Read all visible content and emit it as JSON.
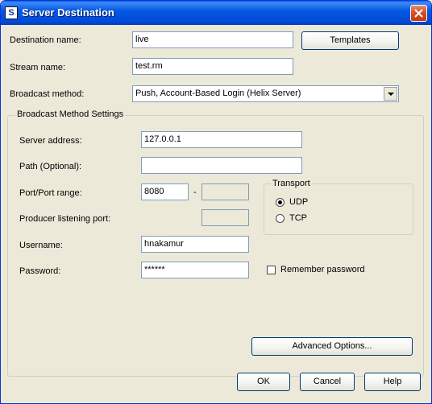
{
  "window": {
    "title": "Server Destination"
  },
  "form": {
    "destination_name": {
      "label": "Destination name:",
      "value": "live"
    },
    "templates_button": "Templates",
    "stream_name": {
      "label": "Stream name:",
      "value": "test.rm"
    },
    "broadcast_method": {
      "label": "Broadcast method:",
      "value": "Push, Account-Based Login (Helix Server)"
    }
  },
  "settings": {
    "group_title": "Broadcast Method Settings",
    "server_address": {
      "label": "Server address:",
      "value": "127.0.0.1"
    },
    "path": {
      "label": "Path (Optional):",
      "value": ""
    },
    "port_range": {
      "label": "Port/Port range:",
      "value_from": "8080",
      "separator": "-",
      "value_to": ""
    },
    "producer_port": {
      "label": "Producer listening port:",
      "value": ""
    },
    "username": {
      "label": "Username:",
      "value": "hnakamur"
    },
    "password": {
      "label": "Password:",
      "value": "******"
    },
    "remember_password": {
      "label": "Remember password",
      "checked": false
    },
    "transport": {
      "title": "Transport",
      "options": [
        {
          "label": "UDP",
          "selected": true
        },
        {
          "label": "TCP",
          "selected": false
        }
      ]
    },
    "advanced_button": "Advanced Options..."
  },
  "footer": {
    "ok": "OK",
    "cancel": "Cancel",
    "help": "Help"
  }
}
